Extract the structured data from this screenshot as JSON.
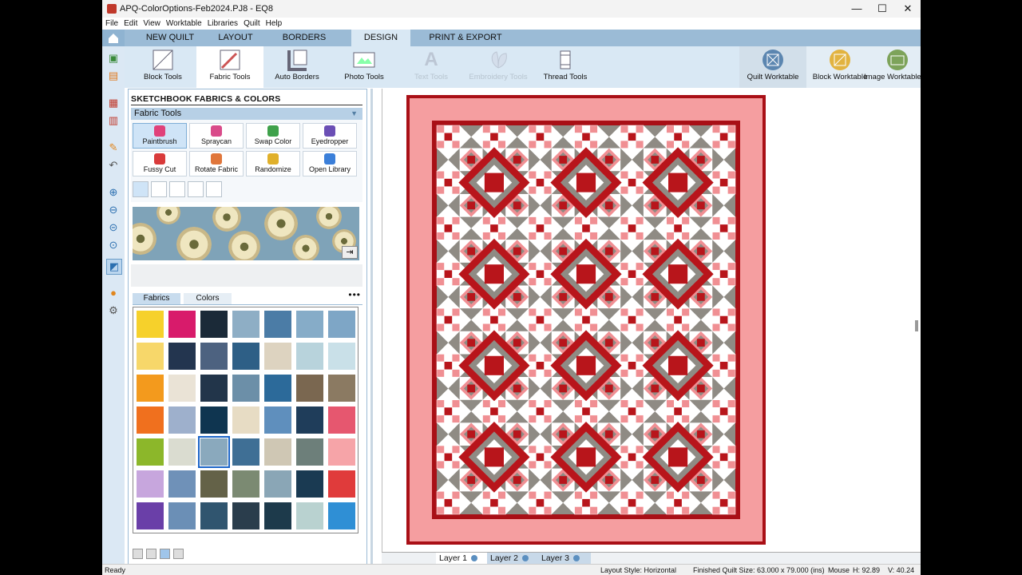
{
  "window": {
    "title": "APQ-ColorOptions-Feb2024.PJ8 - EQ8",
    "minimize": "—",
    "maximize": "☐",
    "close": "✕"
  },
  "menu": [
    "File",
    "Edit",
    "View",
    "Worktable",
    "Libraries",
    "Quilt",
    "Help"
  ],
  "tabs": [
    {
      "label": "NEW QUILT"
    },
    {
      "label": "LAYOUT"
    },
    {
      "label": "BORDERS"
    },
    {
      "label": "DESIGN",
      "active": true
    },
    {
      "label": "PRINT & EXPORT"
    }
  ],
  "ribbon": {
    "tools": [
      {
        "label": "Block Tools",
        "icon": "block-tools-icon"
      },
      {
        "label": "Fabric Tools",
        "icon": "fabric-tools-icon",
        "active": true
      },
      {
        "label": "Auto Borders",
        "icon": "auto-borders-icon"
      },
      {
        "label": "Photo Tools",
        "icon": "photo-tools-icon"
      },
      {
        "label": "Text Tools",
        "icon": "text-tools-icon",
        "disabled": true
      },
      {
        "label": "Embroidery Tools",
        "icon": "embroidery-tools-icon",
        "disabled": true
      },
      {
        "label": "Thread Tools",
        "icon": "thread-tools-icon"
      }
    ],
    "worktables": [
      {
        "label": "Quilt Worktable",
        "icon": "quilt-worktable-icon",
        "active": true
      },
      {
        "label": "Block Worktable",
        "icon": "block-worktable-icon"
      },
      {
        "label": "Image Worktable",
        "icon": "image-worktable-icon"
      }
    ]
  },
  "panel": {
    "title": "SKETCHBOOK FABRICS & COLORS",
    "tools_header": "Fabric Tools",
    "tools": [
      {
        "label": "Paintbrush",
        "active": true,
        "color": "#e0417a"
      },
      {
        "label": "Spraycan",
        "color": "#d94b8a"
      },
      {
        "label": "Swap Color",
        "color": "#3fa14b"
      },
      {
        "label": "Eyedropper",
        "color": "#6b4fb5"
      },
      {
        "label": "Fussy Cut",
        "color": "#d93b3b"
      },
      {
        "label": "Rotate Fabric",
        "color": "#e0763b"
      },
      {
        "label": "Randomize",
        "color": "#e0b02b"
      },
      {
        "label": "Open Library",
        "color": "#3b7fd9"
      }
    ],
    "subtabs": [
      {
        "label": "Fabrics",
        "active": true
      },
      {
        "label": "Colors"
      }
    ],
    "more": "•••"
  },
  "fabric_colors": [
    [
      "#f6d12b",
      "#d81b6b",
      "#1b2a38",
      "#8eaec5",
      "#4b7ca6",
      "#86acc8",
      "#7ea6c6"
    ],
    [
      "#f7d76a",
      "#23354f",
      "#4d6280",
      "#2e5f86",
      "#ddd3c0",
      "#b8d3dc",
      "#c9e0e8"
    ],
    [
      "#f39a1d",
      "#eae3d6",
      "#22354a",
      "#6c8fa8",
      "#2c6a9a",
      "#7a6750",
      "#8b7a62"
    ],
    [
      "#f0701e",
      "#9eb0cc",
      "#0f3550",
      "#e7dcc4",
      "#5f8fbd",
      "#1f3d5a",
      "#e6576f"
    ],
    [
      "#8cb72a",
      "#dadcd0",
      "#8aa9bd",
      "#3f6f95",
      "#cfc7b4",
      "#6d7f7a",
      "#f6a4a8"
    ],
    [
      "#c7a6dd",
      "#6f91b8",
      "#646248",
      "#7b8a72",
      "#8aa6b6",
      "#1a3a52",
      "#e03b3b"
    ],
    [
      "#6a3fa8",
      "#6b8fb6",
      "#30556f",
      "#2a3d4c",
      "#1d3a4b",
      "#b9d2d0",
      "#2f8fd5"
    ]
  ],
  "quilt": {
    "border_color": "#f59ea0",
    "binding_color": "#a90f16",
    "block_red": "#b8151b",
    "block_pink": "#f08f93",
    "block_grey": "#8f8b84",
    "background": "#ffffff"
  },
  "layers": [
    {
      "label": "Layer 1",
      "active": true
    },
    {
      "label": "Layer 2"
    },
    {
      "label": "Layer 3"
    }
  ],
  "status": {
    "ready": "Ready",
    "layout_style": "Layout Style: Horizontal",
    "finished_size": "Finished Quilt Size: 63.000 x 79.000 (ins)",
    "mouse_label": "Mouse",
    "mouse_h": "H:  92.89",
    "mouse_v": "V:  40.24"
  }
}
